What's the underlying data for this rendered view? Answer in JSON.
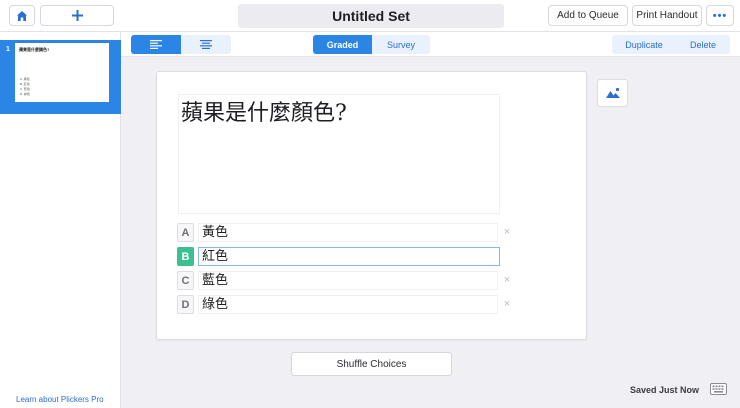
{
  "topbar": {
    "home_icon": "home-icon",
    "add_icon": "plus-icon",
    "title": "Untitled Set",
    "add_to_queue": "Add to Queue",
    "print_handout": "Print Handout",
    "more_icon": "more-horizontal-icon",
    "more_label": "•••"
  },
  "sidebar": {
    "slides": [
      {
        "number": "1",
        "question": "蘋果是什麼顏色?",
        "choices": [
          "A. 黃色",
          "B. 紅色",
          "C. 藍色",
          "D. 綠色"
        ]
      }
    ],
    "learn_link": "Learn about Plickers Pro"
  },
  "toolbar": {
    "align_left_icon": "align-left-icon",
    "align_center_icon": "align-center-icon",
    "graded": "Graded",
    "survey": "Survey",
    "duplicate": "Duplicate",
    "delete": "Delete"
  },
  "editor": {
    "question": "蘋果是什麼顏色?",
    "choices": [
      {
        "letter": "A",
        "text": "黃色",
        "correct": false
      },
      {
        "letter": "B",
        "text": "紅色",
        "correct": true
      },
      {
        "letter": "C",
        "text": "藍色",
        "correct": false
      },
      {
        "letter": "D",
        "text": "綠色",
        "correct": false
      }
    ],
    "remove_label": "×",
    "image_icon": "image-icon",
    "shuffle": "Shuffle Choices"
  },
  "status": {
    "saved": "Saved Just Now",
    "keyboard_icon": "keyboard-icon"
  },
  "colors": {
    "accent": "#2b85e4",
    "correct": "#3cc08f"
  }
}
